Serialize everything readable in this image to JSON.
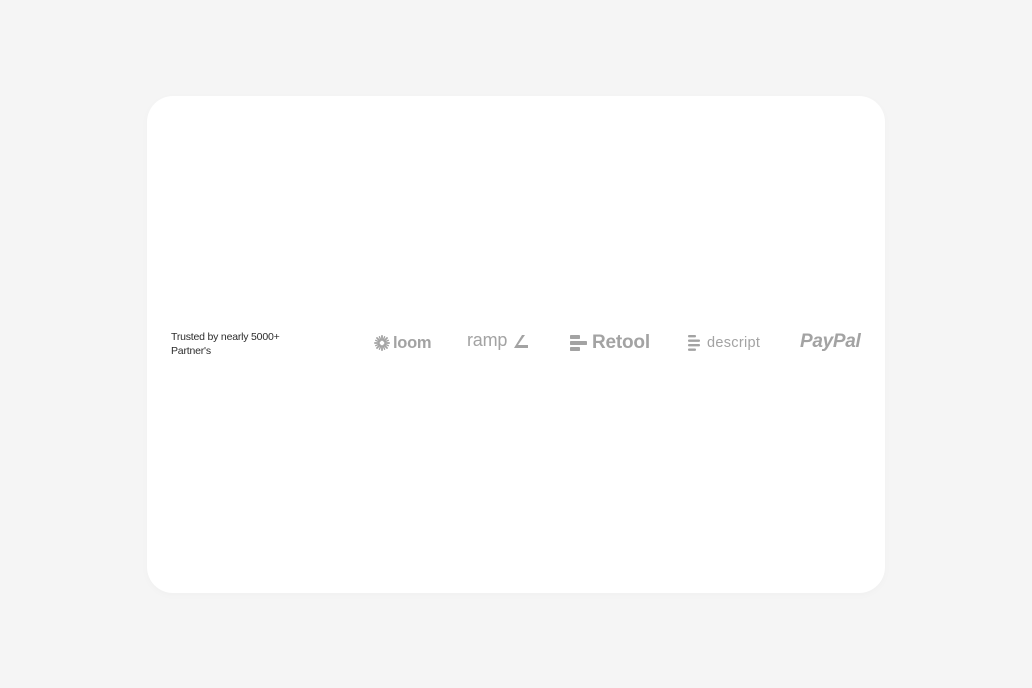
{
  "trusted_text": "Trusted by nearly 5000+ Partner's",
  "logos": {
    "loom": "loom",
    "ramp": "ramp",
    "retool": "Retool",
    "descript": "descript",
    "paypal": "PayPal"
  },
  "colors": {
    "page_background": "#f5f5f5",
    "card_background": "#ffffff",
    "text": "#2c2c2c",
    "logo_gray": "#a3a3a3"
  },
  "icons": {
    "loom": "loom-starburst-icon",
    "ramp": "ramp-arrow-icon",
    "retool": "retool-bars-icon",
    "descript": "descript-lines-icon"
  }
}
